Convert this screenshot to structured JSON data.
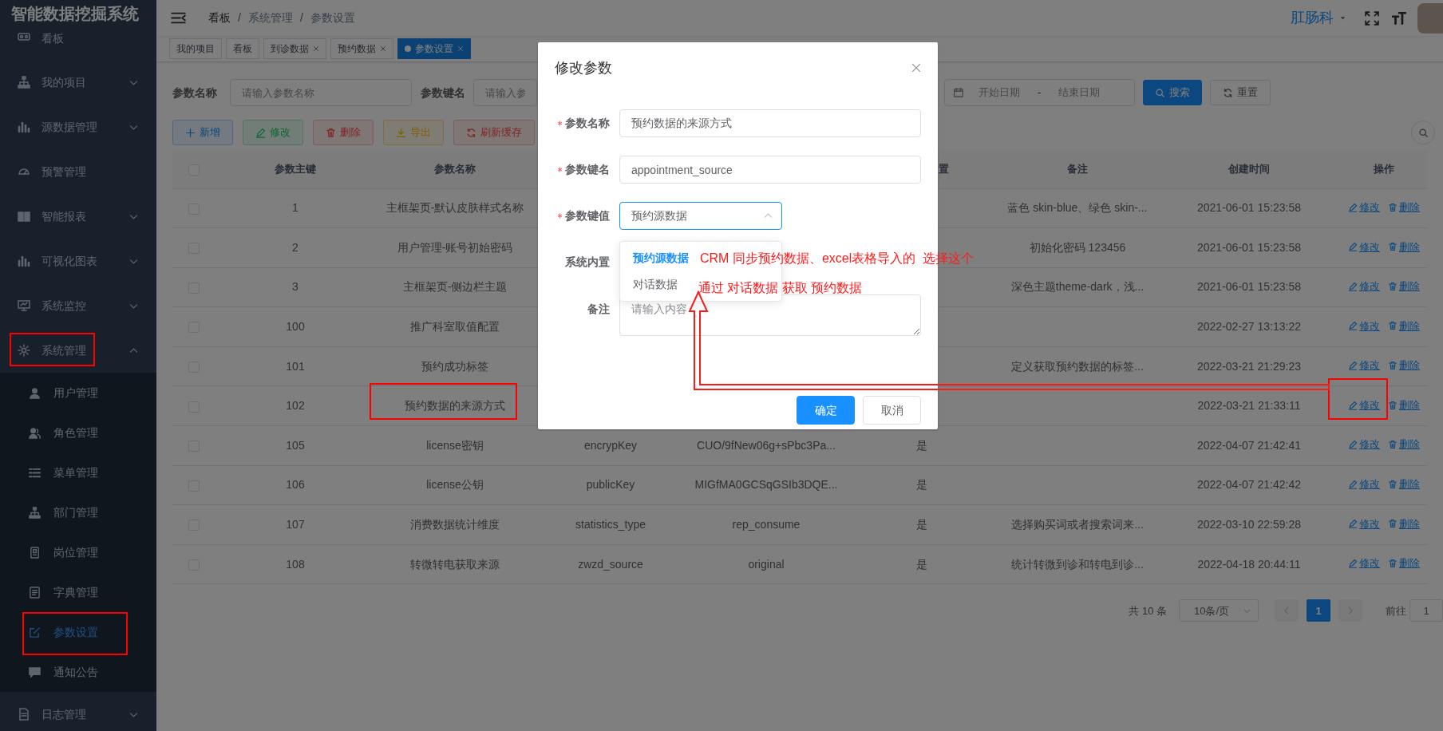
{
  "sidebar": {
    "title": "智能数据挖掘系统",
    "items": [
      {
        "label": "看板",
        "selected": false
      },
      {
        "label": "我的项目",
        "selected": false,
        "expanded": false
      },
      {
        "label": "源数据管理",
        "selected": false,
        "expanded": false
      },
      {
        "label": "预警管理",
        "selected": false
      },
      {
        "label": "智能报表",
        "selected": false,
        "expanded": false
      },
      {
        "label": "可视化图表",
        "selected": false,
        "expanded": false
      },
      {
        "label": "系统监控",
        "selected": false,
        "expanded": false
      },
      {
        "label": "系统管理",
        "selected": false,
        "expanded": true,
        "children": [
          {
            "label": "用户管理",
            "selected": false
          },
          {
            "label": "角色管理",
            "selected": false
          },
          {
            "label": "菜单管理",
            "selected": false
          },
          {
            "label": "部门管理",
            "selected": false
          },
          {
            "label": "岗位管理",
            "selected": false
          },
          {
            "label": "字典管理",
            "selected": false
          },
          {
            "label": "参数设置",
            "selected": true
          },
          {
            "label": "通知公告",
            "selected": false
          }
        ]
      },
      {
        "label": "日志管理",
        "selected": false,
        "expanded": false
      }
    ]
  },
  "header": {
    "breadcrumb": [
      "看板",
      "系统管理",
      "参数设置"
    ],
    "separator": "/",
    "department": "肛肠科"
  },
  "tags": [
    {
      "label": "我的项目",
      "closable": false,
      "selected": false
    },
    {
      "label": "看板",
      "closable": false,
      "selected": false
    },
    {
      "label": "到诊数据",
      "closable": true,
      "selected": false
    },
    {
      "label": "预约数据",
      "closable": true,
      "selected": false
    },
    {
      "label": "参数设置",
      "closable": true,
      "selected": true
    }
  ],
  "search": {
    "fields": [
      {
        "label": "参数名称",
        "placeholder": "请输入参数名称"
      },
      {
        "label": "参数键名",
        "placeholder": "请输入参"
      }
    ],
    "date_range": {
      "start_placeholder": "开始日期",
      "separator": "-",
      "end_placeholder": "结束日期"
    },
    "buttons": [
      {
        "label": "搜索",
        "kind": "primary"
      },
      {
        "label": "重置",
        "kind": "default"
      }
    ]
  },
  "toolbar": [
    {
      "label": "新增",
      "kind": "primary"
    },
    {
      "label": "修改",
      "kind": "success"
    },
    {
      "label": "删除",
      "kind": "danger"
    },
    {
      "label": "导出",
      "kind": "warning"
    },
    {
      "label": "刷新缓存",
      "kind": "danger"
    }
  ],
  "table": {
    "select_all": {
      "checked": false
    },
    "columns": [
      {
        "label": "参数主键"
      },
      {
        "label": "参数名称"
      },
      {},
      {},
      {
        "label": "置"
      },
      {
        "label": "备注"
      },
      {
        "label": "创建时间"
      },
      {
        "label": "操作"
      }
    ],
    "rows": [
      {
        "checked": false,
        "cells": [
          "1",
          "主框架页-默认皮肤样式名称",
          null,
          null,
          null,
          "蓝色 skin-blue、绿色 skin-...",
          "2021-06-01 15:23:58"
        ],
        "actions": [
          "修改",
          "删除"
        ]
      },
      {
        "checked": false,
        "cells": [
          "2",
          "用户管理-账号初始密码",
          null,
          null,
          null,
          "初始化密码 123456",
          "2021-06-01 15:23:58"
        ],
        "actions": [
          "修改",
          "删除"
        ]
      },
      {
        "checked": false,
        "cells": [
          "3",
          "主框架页-侧边栏主题",
          null,
          null,
          null,
          "深色主题theme-dark，浅...",
          "2021-06-01 15:23:58"
        ],
        "actions": [
          "修改",
          "删除"
        ]
      },
      {
        "checked": false,
        "cells": [
          "100",
          "推广科室取值配置",
          null,
          null,
          null,
          null,
          "2022-02-27 13:13:22"
        ],
        "actions": [
          "修改",
          "删除"
        ]
      },
      {
        "checked": false,
        "cells": [
          "101",
          "预约成功标签",
          null,
          null,
          null,
          "定义获取预约数据的标签...",
          "2022-03-21 21:29:23"
        ],
        "actions": [
          "修改",
          "删除"
        ]
      },
      {
        "checked": false,
        "cells": [
          "102",
          "预约数据的来源方式",
          null,
          null,
          null,
          null,
          "2022-03-21 21:33:11"
        ],
        "actions": [
          "修改",
          "删除"
        ]
      },
      {
        "checked": false,
        "cells": [
          "105",
          "license密钥",
          "encrypKey",
          "CUO/9fNew06g+sPbc3Pa...",
          "是",
          null,
          "2022-04-07 21:42:41"
        ],
        "actions": [
          "修改",
          "删除"
        ]
      },
      {
        "checked": false,
        "cells": [
          "106",
          "license公钥",
          "publicKey",
          "MIGfMA0GCSqGSIb3DQE...",
          "是",
          null,
          "2022-04-07 21:42:42"
        ],
        "actions": [
          "修改",
          "删除"
        ]
      },
      {
        "checked": false,
        "cells": [
          "107",
          "消费数据统计维度",
          "statistics_type",
          "rep_consume",
          "是",
          "选择购买词或者搜索词来...",
          "2022-03-10 22:59:28"
        ],
        "actions": [
          "修改",
          "删除"
        ]
      },
      {
        "checked": false,
        "cells": [
          "108",
          "转微转电获取来源",
          "zwzd_source",
          "original",
          "是",
          "统计转微到诊和转电到诊...",
          "2022-04-18 20:44:11"
        ],
        "actions": [
          "修改",
          "删除"
        ]
      }
    ]
  },
  "pagination": {
    "total": "共 10 条",
    "page_size": "10条/页",
    "pages": [
      {
        "label": "1",
        "selected": true
      }
    ],
    "goto_label": "前往",
    "goto_value": "1"
  },
  "modal": {
    "title": "修改参数",
    "fields": [
      {
        "label": "参数名称",
        "required": true,
        "kind": "input",
        "value": "预约数据的来源方式"
      },
      {
        "label": "参数键名",
        "required": true,
        "kind": "input",
        "value": "appointment_source"
      },
      {
        "label": "参数键值",
        "required": true,
        "kind": "select",
        "value": "预约源数据",
        "open": true,
        "options": [
          {
            "label": "预约源数据",
            "selected": true
          },
          {
            "label": "对话数据",
            "selected": false
          }
        ]
      },
      {
        "label": "系统内置",
        "required": false,
        "kind": "radio"
      },
      {
        "label": "备注",
        "required": false,
        "kind": "textarea",
        "placeholder": "请输入内容"
      }
    ],
    "buttons": [
      {
        "label": "确定",
        "kind": "primary"
      },
      {
        "label": "取消",
        "kind": "default"
      }
    ]
  },
  "annotations": {
    "notes": [
      "CRM 同步预约数据、excel表格导入的  选择这个",
      "通过 对话数据 获取 预约数据"
    ]
  }
}
